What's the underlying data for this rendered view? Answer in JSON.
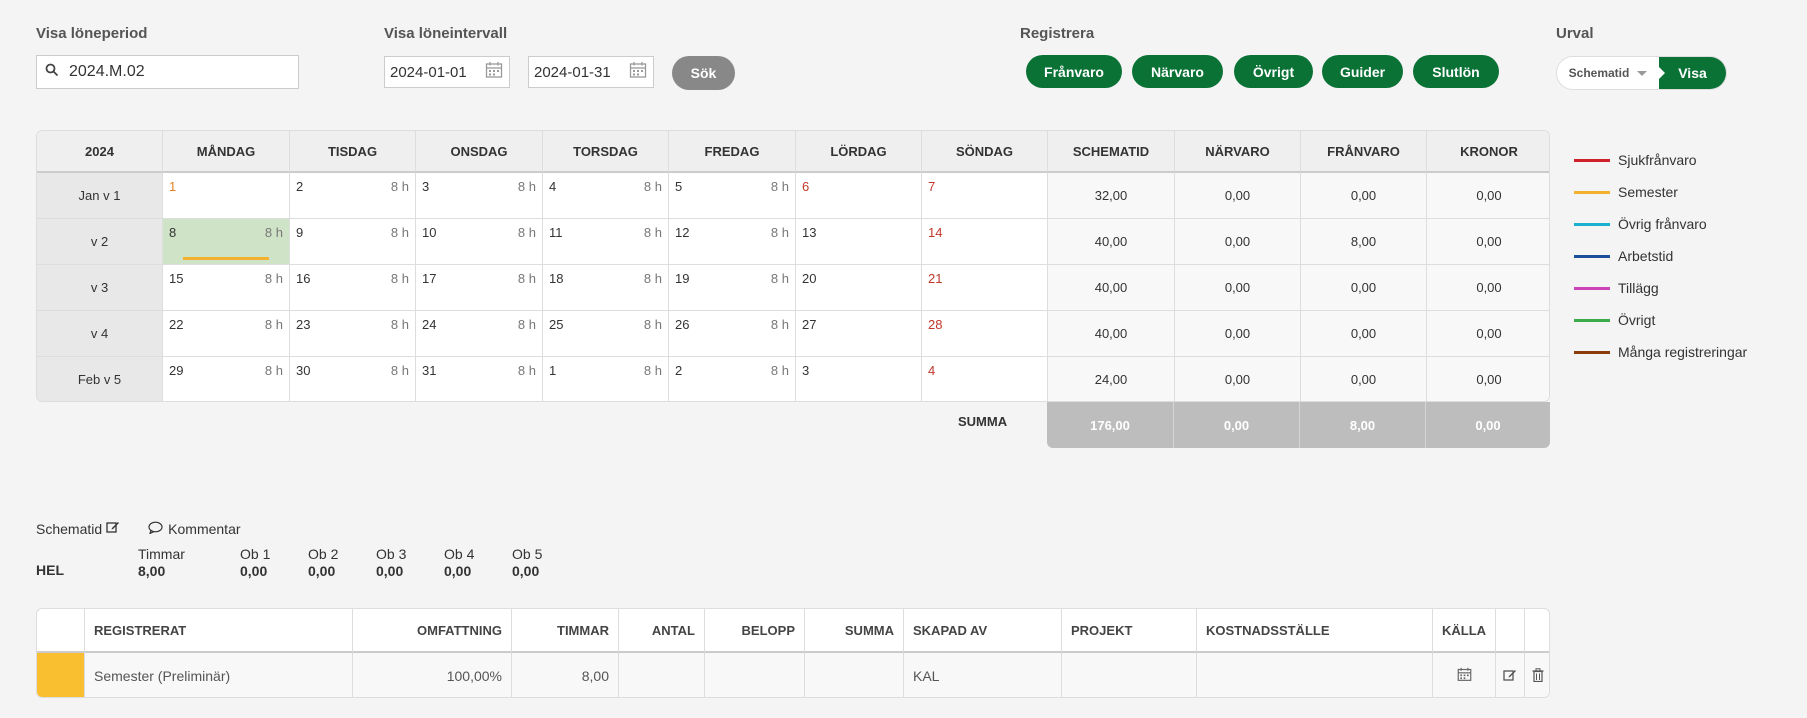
{
  "filters": {
    "period_label": "Visa löneperiod",
    "period_value": "2024.M.02",
    "interval_label": "Visa löneintervall",
    "date_from": "2024-01-01",
    "date_to": "2024-01-31",
    "search_button": "Sök",
    "register_label": "Registrera",
    "register_buttons": [
      "Frånvaro",
      "Närvaro",
      "Övrigt",
      "Guider",
      "Slutlön"
    ],
    "urval_label": "Urval",
    "urval_select": "Schematid",
    "urval_button": "Visa"
  },
  "calendar": {
    "year": "2024",
    "day_headers": [
      "MÅNDAG",
      "TISDAG",
      "ONSDAG",
      "TORSDAG",
      "FREDAG",
      "LÖRDAG",
      "SÖNDAG"
    ],
    "summary_headers": [
      "SCHEMATID",
      "NÄRVARO",
      "FRÅNVARO",
      "KRONOR"
    ],
    "hours_text": "8 h",
    "weeks": [
      {
        "label": "Jan v 1",
        "days": [
          "1",
          "2",
          "3",
          "4",
          "5",
          "6",
          "7"
        ],
        "summary": [
          "32,00",
          "0,00",
          "0,00",
          "0,00"
        ]
      },
      {
        "label": "v 2",
        "days": [
          "8",
          "9",
          "10",
          "11",
          "12",
          "13",
          "14"
        ],
        "summary": [
          "40,00",
          "0,00",
          "8,00",
          "0,00"
        ]
      },
      {
        "label": "v 3",
        "days": [
          "15",
          "16",
          "17",
          "18",
          "19",
          "20",
          "21"
        ],
        "summary": [
          "40,00",
          "0,00",
          "0,00",
          "0,00"
        ]
      },
      {
        "label": "v 4",
        "days": [
          "22",
          "23",
          "24",
          "25",
          "26",
          "27",
          "28"
        ],
        "summary": [
          "40,00",
          "0,00",
          "0,00",
          "0,00"
        ]
      },
      {
        "label": "Feb v 5",
        "days": [
          "29",
          "30",
          "31",
          "1",
          "2",
          "3",
          "4"
        ],
        "summary": [
          "24,00",
          "0,00",
          "0,00",
          "0,00"
        ]
      }
    ],
    "sum_label": "SUMMA",
    "totals": [
      "176,00",
      "0,00",
      "8,00",
      "0,00"
    ]
  },
  "legend": [
    {
      "label": "Sjukfrånvaro",
      "color": "#d0202a"
    },
    {
      "label": "Semester",
      "color": "#f2b230"
    },
    {
      "label": "Övrig frånvaro",
      "color": "#1ab0d0"
    },
    {
      "label": "Arbetstid",
      "color": "#1a4f9c"
    },
    {
      "label": "Tillägg",
      "color": "#cc44b8"
    },
    {
      "label": "Övrigt",
      "color": "#3aaa4a"
    },
    {
      "label": "Många registreringar",
      "color": "#8b3c0c"
    }
  ],
  "schema": {
    "schematid_label": "Schematid",
    "kommentar_label": "Kommentar",
    "row_label": "HEL",
    "columns": [
      {
        "label": "Timmar",
        "value": "8,00"
      },
      {
        "label": "Ob 1",
        "value": "0,00"
      },
      {
        "label": "Ob 2",
        "value": "0,00"
      },
      {
        "label": "Ob 3",
        "value": "0,00"
      },
      {
        "label": "Ob 4",
        "value": "0,00"
      },
      {
        "label": "Ob 5",
        "value": "0,00"
      }
    ]
  },
  "registrations": {
    "headers": [
      "REGISTRERAT",
      "OMFATTNING",
      "TIMMAR",
      "ANTAL",
      "BELOPP",
      "SUMMA",
      "SKAPAD AV",
      "PROJEKT",
      "KOSTNADSSTÄLLE",
      "KÄLLA"
    ],
    "rows": [
      {
        "registrerat": "Semester (Preliminär)",
        "omfattning": "100,00%",
        "timmar": "8,00",
        "antal": "",
        "belopp": "",
        "summa": "",
        "skapad_av": "KAL",
        "projekt": "",
        "kostnadsstalle": "",
        "color": "#f9bf31"
      }
    ]
  }
}
